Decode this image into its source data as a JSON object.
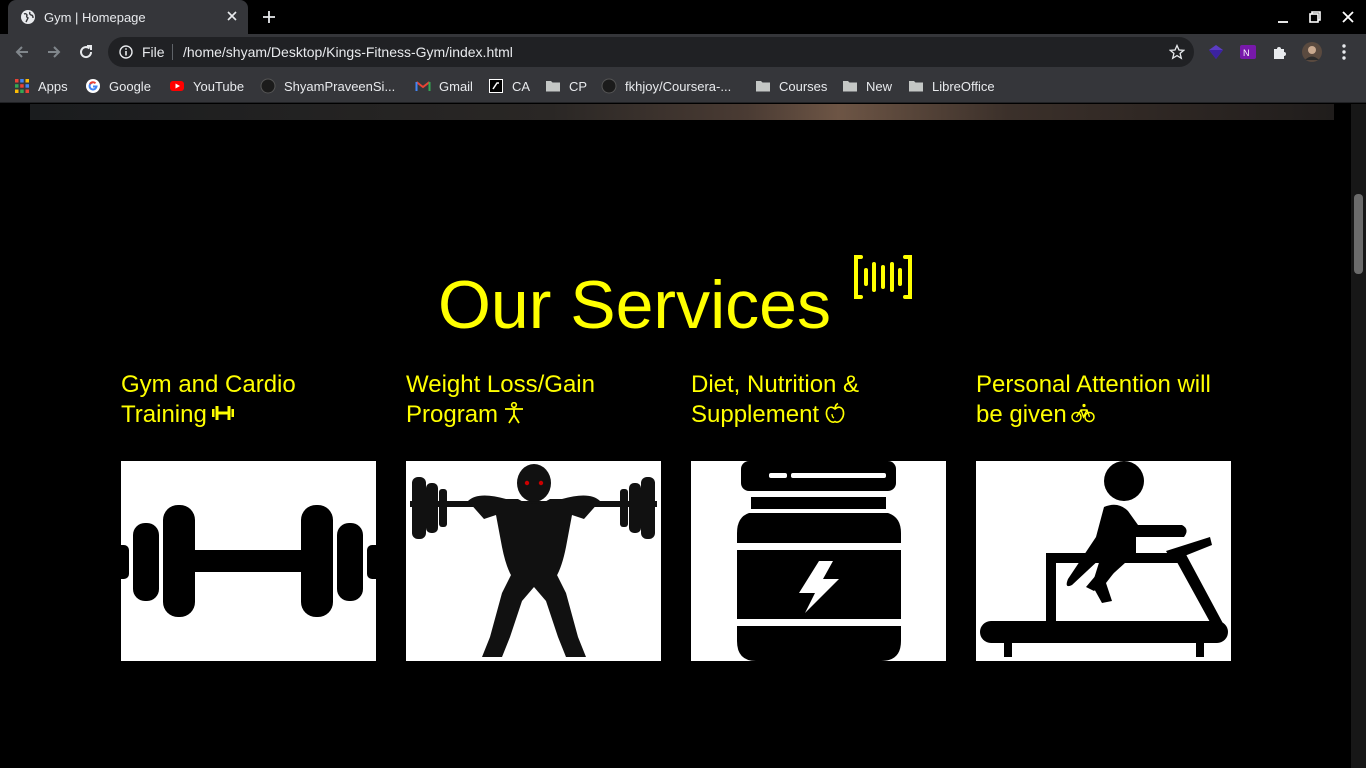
{
  "browser": {
    "tab": {
      "title": "Gym | Homepage"
    },
    "omnibox": {
      "scheme": "File",
      "url": "/home/shyam/Desktop/Kings-Fitness-Gym/index.html"
    },
    "bookmarks": [
      {
        "label": "Apps",
        "icon": "apps-grid-icon"
      },
      {
        "label": "Google",
        "icon": "google-icon"
      },
      {
        "label": "YouTube",
        "icon": "youtube-icon"
      },
      {
        "label": "ShyamPraveenSi...",
        "icon": "github-icon"
      },
      {
        "label": "Gmail",
        "icon": "gmail-icon"
      },
      {
        "label": "CA",
        "icon": "ca-icon"
      },
      {
        "label": "CP",
        "icon": "folder-icon"
      },
      {
        "label": "fkhjoy/Coursera-...",
        "icon": "github-icon"
      },
      {
        "label": "Courses",
        "icon": "folder-icon"
      },
      {
        "label": "New",
        "icon": "folder-icon"
      },
      {
        "label": "LibreOffice",
        "icon": "folder-icon"
      }
    ]
  },
  "page": {
    "services": {
      "title": "Our Services",
      "title_icon": "sound-wave-icon",
      "accent_color": "#ffff00",
      "cards": [
        {
          "title": "Gym and Cardio Training",
          "icon": "dumbbell-icon",
          "image": "dumbbell-image"
        },
        {
          "title": "Weight Loss/Gain Program",
          "icon": "person-icon",
          "image": "weightlifter-image"
        },
        {
          "title": "Diet, Nutrition & Supplement",
          "icon": "apple-icon",
          "image": "supplement-jar-image"
        },
        {
          "title": "Personal Attention will be given",
          "icon": "bicycle-icon",
          "image": "treadmill-runner-image"
        }
      ]
    }
  }
}
